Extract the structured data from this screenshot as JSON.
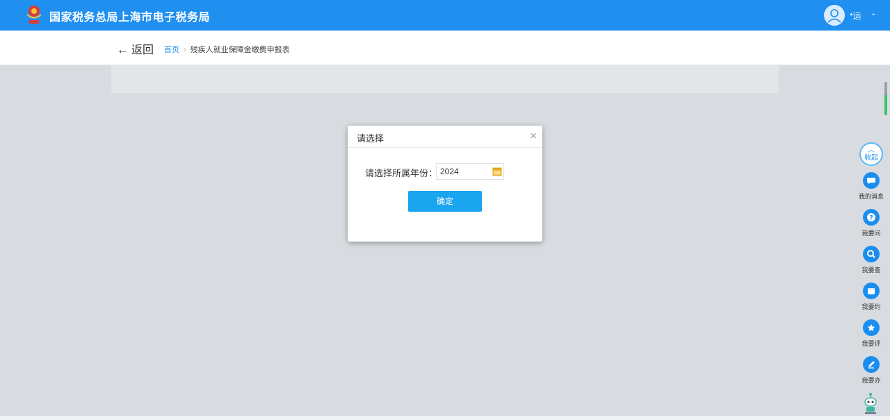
{
  "header": {
    "title": "国家税务总局上海市电子税务局",
    "user_name": "*运",
    "user_caret": "⌄"
  },
  "nav": {
    "back_arrow": "←",
    "back_label": "返回",
    "breadcrumb_home": "首页",
    "breadcrumb_sep": "›",
    "breadcrumb_current": "残疾人就业保障金缴费申报表"
  },
  "dialog": {
    "title": "请选择",
    "close": "×",
    "year_label": "请选择所属年份：",
    "year_value": "2024",
    "confirm_label": "确定"
  },
  "sidebar": {
    "collapse_chevron": "︿",
    "collapse_label": "收起",
    "items": [
      {
        "icon": "message-icon",
        "label": "我的消息"
      },
      {
        "icon": "question-icon",
        "label": "我要问"
      },
      {
        "icon": "search-icon",
        "label": "我要查"
      },
      {
        "icon": "calendar-icon",
        "label": "我要约"
      },
      {
        "icon": "rate-icon",
        "label": "我要评"
      },
      {
        "icon": "edit-icon",
        "label": "我要办"
      }
    ]
  },
  "colors": {
    "primary": "#1f8ff0",
    "button": "#1aa6ee",
    "background": "#d8dbe0"
  }
}
